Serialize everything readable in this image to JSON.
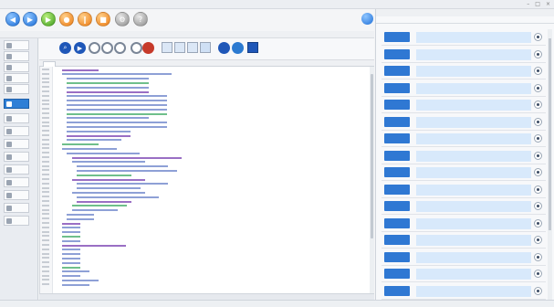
{
  "window": {
    "title": ""
  },
  "main_toolbar": {
    "buttons": [
      {
        "icon": "blue-circle-icon",
        "color": "#1e6fd8"
      },
      {
        "icon": "blue-circle-icon",
        "color": "#1e6fd8"
      },
      {
        "icon": "green-circle-icon",
        "color": "#3f9c1e"
      },
      {
        "icon": "orange-circle-icon",
        "color": "#ec7a12"
      },
      {
        "icon": "orange-circle-icon",
        "color": "#ec7a12"
      },
      {
        "icon": "orange-circle-icon",
        "color": "#ec7a12"
      },
      {
        "icon": "gray-circle-icon",
        "color": "#8d8d8d"
      },
      {
        "icon": "gray-circle-icon",
        "color": "#8d8d8d"
      }
    ]
  },
  "menu": {
    "items": [
      "",
      "",
      ""
    ]
  },
  "editor_tab": {
    "label": ""
  },
  "status": {
    "text": ""
  },
  "bottom": {
    "text": ""
  },
  "accent": "#2f78d3"
}
